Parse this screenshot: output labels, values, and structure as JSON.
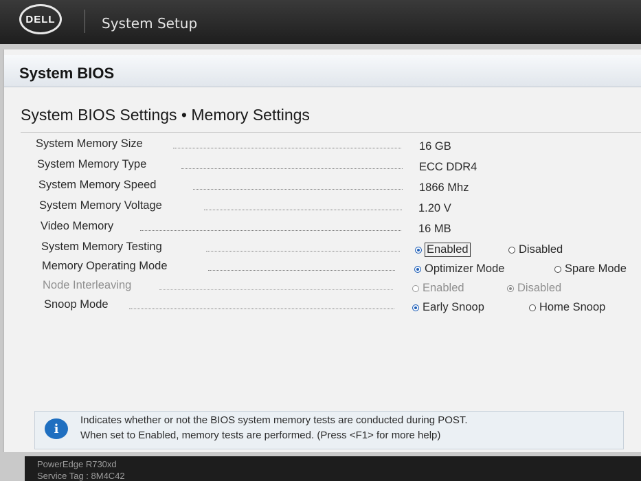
{
  "app": {
    "brand": "DELL",
    "title": "System Setup"
  },
  "header": {
    "title": "System BIOS"
  },
  "breadcrumb": "System BIOS Settings • Memory Settings",
  "info_rows": [
    {
      "label": "System Memory Size",
      "value": "16 GB"
    },
    {
      "label": "System Memory Type",
      "value": "ECC DDR4"
    },
    {
      "label": "System Memory Speed",
      "value": "1866 Mhz"
    },
    {
      "label": "System Memory Voltage",
      "value": "1.20 V"
    },
    {
      "label": "Video Memory",
      "value": "16 MB"
    }
  ],
  "settings": {
    "memory_testing": {
      "label": "System Memory Testing",
      "options": [
        "Enabled",
        "Disabled"
      ],
      "selected": "Enabled"
    },
    "operating_mode": {
      "label": "Memory Operating Mode",
      "options": [
        "Optimizer Mode",
        "Spare Mode"
      ],
      "selected": "Optimizer Mode"
    },
    "node_interleaving": {
      "label": "Node Interleaving",
      "options": [
        "Enabled",
        "Disabled"
      ],
      "selected": "Disabled",
      "disabled": true
    },
    "snoop_mode": {
      "label": "Snoop Mode",
      "options": [
        "Early Snoop",
        "Home Snoop"
      ],
      "selected": "Early Snoop"
    }
  },
  "help": {
    "line1": "Indicates whether or not the BIOS system memory tests are conducted during POST.",
    "line2": "When set to Enabled, memory tests are performed. (Press <F1> for more help)"
  },
  "footer": {
    "model": "PowerEdge R730xd",
    "service_tag": "Service Tag : 8M4C42"
  },
  "colors": {
    "accent": "#1f5fb8",
    "topbar": "#2a2a2a",
    "panel": "#f2f2f2"
  }
}
